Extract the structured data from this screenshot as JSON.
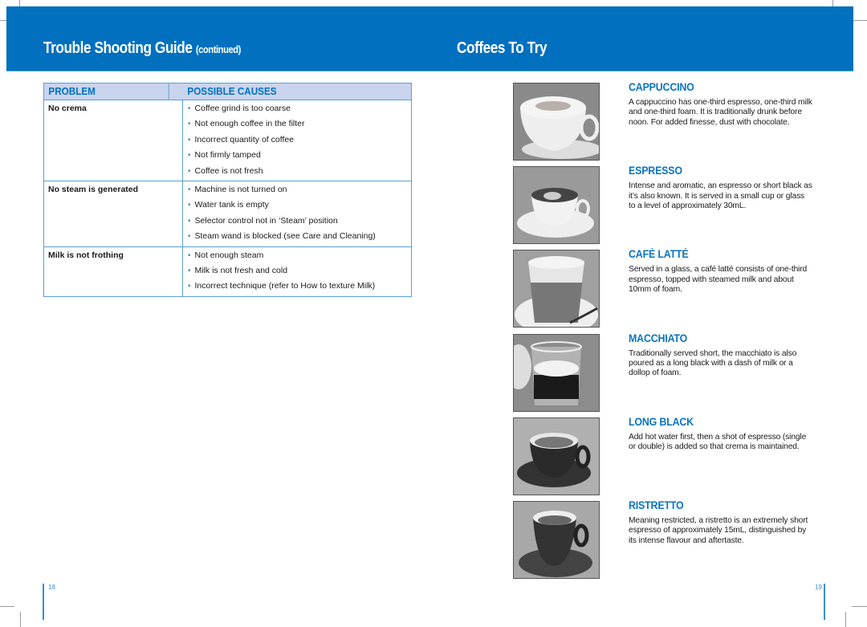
{
  "left_page": {
    "title": "Trouble Shooting Guide",
    "title_suffix": "(continued)",
    "table": {
      "headers": [
        "PROBLEM",
        "POSSIBLE CAUSES"
      ],
      "rows": [
        {
          "problem": "No crema",
          "causes": [
            "Coffee grind is too coarse",
            "Not enough coffee in the filter",
            "Incorrect quantity of coffee",
            "Not firmly tamped",
            "Coffee is not fresh"
          ]
        },
        {
          "problem": "No steam is generated",
          "causes": [
            "Machine is not turned on",
            "Water tank is empty",
            "Selector control not in ‘Steam’ position",
            "Steam wand is blocked (see Care and Cleaning)"
          ]
        },
        {
          "problem": "Milk is not frothing",
          "causes": [
            "Not enough steam",
            "Milk is not fresh and cold",
            "Incorrect technique (refer to How to texture Milk)"
          ]
        }
      ]
    },
    "page_number": "18"
  },
  "right_page": {
    "title": "Coffees To Try",
    "coffees": [
      {
        "name": "CAPPUCCINO",
        "description": "A cappuccino has one-third espresso, one-third milk and one-third foam. It is traditionally drunk before noon. For added finesse, dust with chocolate.",
        "image": "cappuccino-photo"
      },
      {
        "name": "ESPRESSO",
        "description": "Intense and aromatic, an espresso or short black as it’s also known. It is served in a small cup or glass to a level of approximately 30mL.",
        "image": "espresso-photo"
      },
      {
        "name": "CAFÉ LATTÉ",
        "description": "Served in a glass, a café latté consists of one-third espresso, topped with steamed milk and about 10mm of foam.",
        "image": "cafe-latte-photo"
      },
      {
        "name": "MACCHIATO",
        "description": "Traditionally served short, the macchiato is also poured as a long black with a dash of milk or a dollop of foam.",
        "image": "macchiato-photo"
      },
      {
        "name": "LONG BLACK",
        "description": "Add hot water first, then a shot of espresso (single or double) is added so that crema is maintained.",
        "image": "long-black-photo"
      },
      {
        "name": "RISTRETTO",
        "description": "Meaning restricted, a ristretto is an extremely short espresso of approximately 15mL, distinguished by its intense flavour and aftertaste.",
        "image": "ristretto-photo"
      }
    ],
    "page_number": "19"
  },
  "colors": {
    "brand_blue": "#0070bf",
    "header_fill": "#c9d4ee",
    "accent_text": "#0a74c2"
  }
}
